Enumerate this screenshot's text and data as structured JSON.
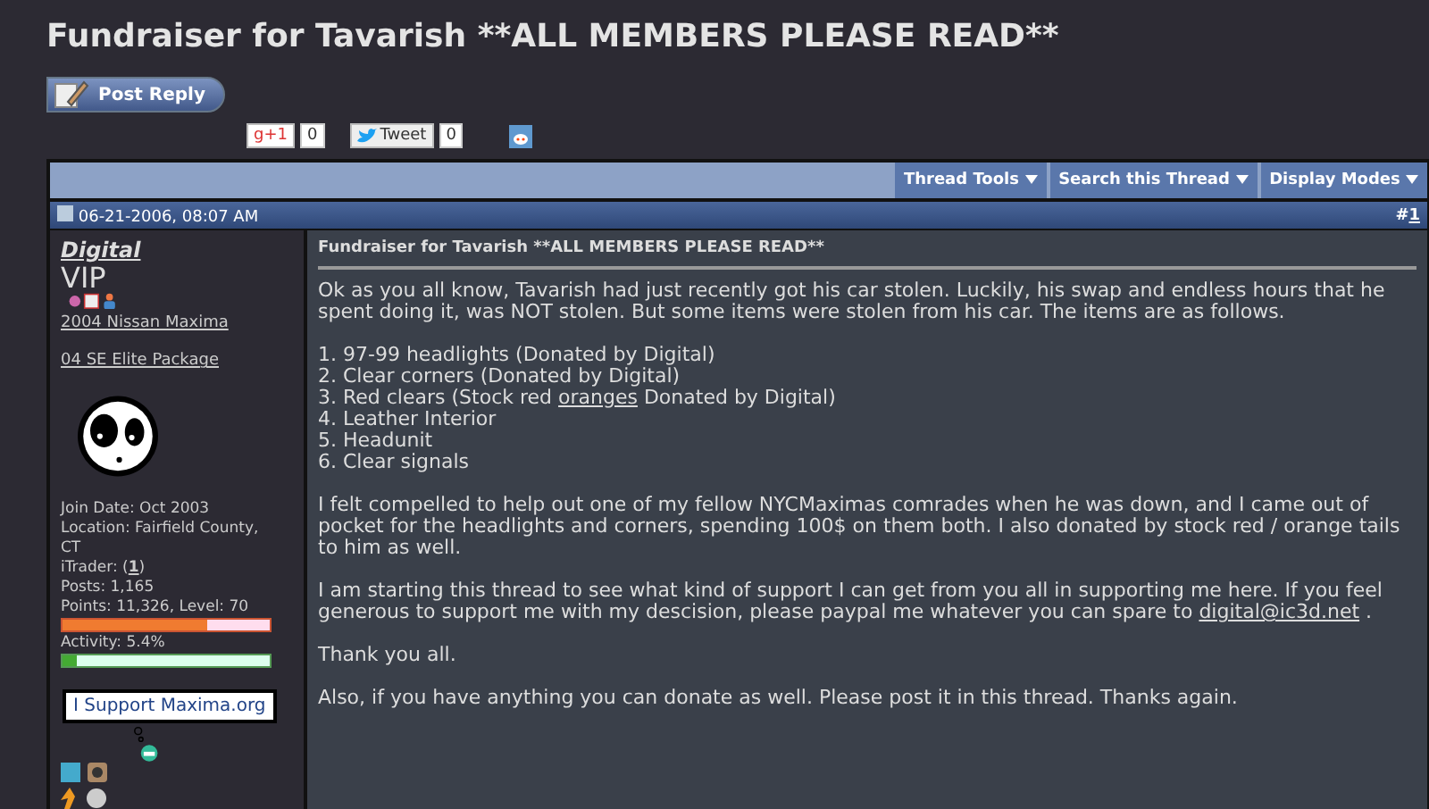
{
  "page_title": "Fundraiser for Tavarish **ALL MEMBERS PLEASE READ**",
  "post_reply": "Post Reply",
  "social": [
    {
      "kind": "gplus",
      "label": "g+1",
      "count": "0"
    },
    {
      "kind": "tweet",
      "label": "Tweet",
      "count": "0"
    },
    {
      "kind": "reddit"
    }
  ],
  "toolbar": [
    "Thread Tools",
    "Search this Thread",
    "Display Modes"
  ],
  "post": {
    "date": "06-21-2006, 08:07 AM",
    "number_prefix": "#",
    "number": "1",
    "user": {
      "name": "Digital",
      "rank": "VIP",
      "car": "2004 Nissan Maxima",
      "package": "04 SE Elite Package",
      "info": [
        {
          "label": "Join Date: Oct 2003"
        },
        {
          "label": "Location: Fairfield County, CT"
        },
        {
          "label": "iTrader: (",
          "link": "1",
          "after": ")"
        },
        {
          "label": "Posts: 1,165"
        },
        {
          "label": "Points: 11,326, Level: 70",
          "level": 0.7,
          "kind": "points"
        },
        {
          "label": "Activity: 5.4%",
          "level": 0.07,
          "kind": "activity"
        }
      ],
      "banner": "I Support Maxima.org"
    },
    "title": "Fundraiser for Tavarish **ALL MEMBERS PLEASE READ**",
    "body": [
      {
        "kind": "text",
        "text": "Ok as you all know, Tavarish had just recently got his car stolen. Luckily, his swap and endless hours that he spent doing it, was NOT stolen. But some items were stolen from his car. The items are as follows."
      },
      {
        "kind": "list",
        "items": [
          {
            "text": "1. 97-99 headlights (Donated by Digital)"
          },
          {
            "text": "2. Clear corners (Donated by Digital)"
          },
          {
            "text": "3. Red clears (Stock red ",
            "link": "oranges",
            "after": " Donated by Digital)"
          },
          {
            "text": "4. Leather Interior"
          },
          {
            "text": "5. Headunit"
          },
          {
            "text": "6. Clear signals"
          }
        ]
      },
      {
        "kind": "text",
        "text": "I felt compelled to help out one of my fellow NYCMaximas comrades when he was down, and I came out of pocket for the headlights and corners, spending 100$ on them both. I also donated by stock red / orange tails to him as well."
      },
      {
        "kind": "text",
        "text": "I am starting this thread to see what kind of support I can get from you all in supporting me here. If you feel generous to support me with my descision, please paypal me whatever you can spare to ",
        "link": "digital@ic3d.net",
        "after": " ."
      },
      {
        "kind": "text",
        "text": "Thank you all."
      },
      {
        "kind": "text",
        "text": "Also, if you have anything you can donate as well. Please post it in this thread. Thanks again."
      }
    ]
  }
}
